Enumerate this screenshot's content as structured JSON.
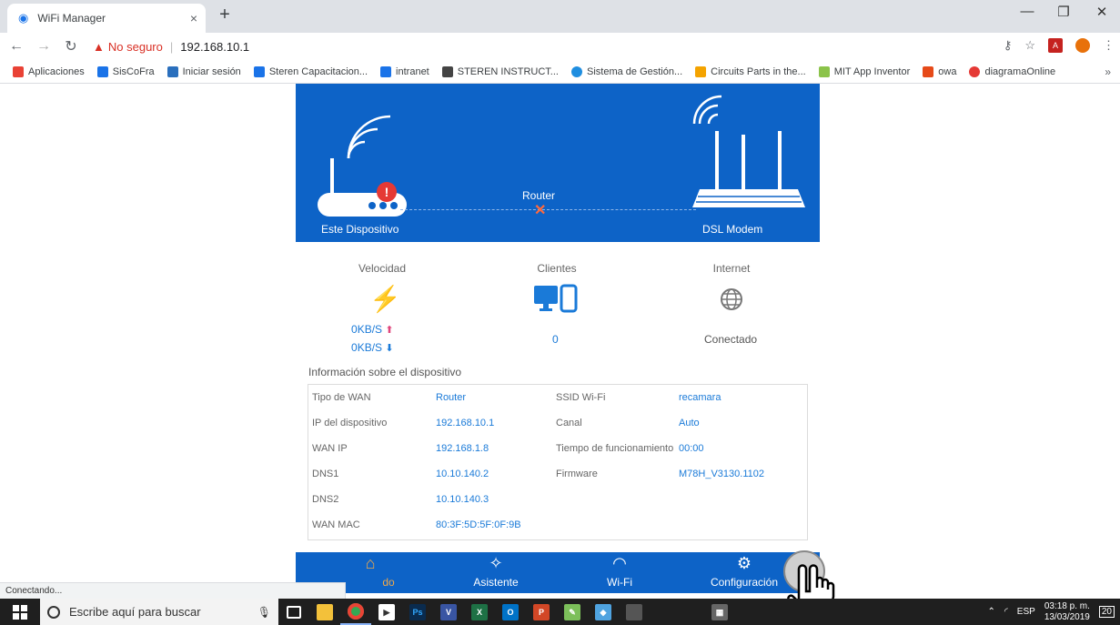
{
  "browser": {
    "tab_title": "WiFi Manager",
    "tab_close": "×",
    "new_tab": "+",
    "not_secure": "No seguro",
    "url": "192.168.10.1",
    "status": "Conectando..."
  },
  "bookmarks": [
    {
      "label": "Aplicaciones",
      "color": "#e94235"
    },
    {
      "label": "SisCoFra",
      "color": "#1a73e8"
    },
    {
      "label": "Iniciar sesión",
      "color": "#2a6fbd"
    },
    {
      "label": "Steren Capacitacion...",
      "color": "#1a73e8"
    },
    {
      "label": "intranet",
      "color": "#1a73e8"
    },
    {
      "label": "STEREN INSTRUCT...",
      "color": "#444444"
    },
    {
      "label": "Sistema de Gestión...",
      "color": "#1f8ee0"
    },
    {
      "label": "Circuits Parts in the...",
      "color": "#f4a300"
    },
    {
      "label": "MIT App Inventor",
      "color": "#8bc34a"
    },
    {
      "label": "owa",
      "color": "#e64a19"
    },
    {
      "label": "diagramaOnline",
      "color": "#e53935"
    }
  ],
  "banner": {
    "device_label": "Este Dispositivo",
    "router_label": "Router",
    "modem_label": "DSL Modem"
  },
  "stats": {
    "speed_label": "Velocidad",
    "speed_up_value": "0",
    "speed_up_unit": "KB/S",
    "speed_down_value": "0",
    "speed_down_unit": "KB/S",
    "clients_label": "Clientes",
    "clients_value": "0",
    "internet_label": "Internet",
    "internet_value": "Conectado"
  },
  "device_info": {
    "title": "Información sobre el dispositivo",
    "wan_type_label": "Tipo de WAN",
    "wan_type_value": "Router",
    "device_ip_label": "IP del dispositivo",
    "device_ip_value": "192.168.10.1",
    "wan_ip_label": "WAN IP",
    "wan_ip_value": "192.168.1.8",
    "dns1_label": "DNS1",
    "dns1_value": "10.10.140.2",
    "dns2_label": "DNS2",
    "dns2_value": "10.10.140.3",
    "wan_mac_label": "WAN MAC",
    "wan_mac_value": "80:3F:5D:5F:0F:9B",
    "ssid_label": "SSID Wi-Fi",
    "ssid_value": "recamara",
    "channel_label": "Canal",
    "channel_value": "Auto",
    "uptime_label": "Tiempo de funcionamiento",
    "uptime_value": "00:00",
    "firmware_label": "Firmware",
    "firmware_value": "M78H_V3130.1102"
  },
  "bottom_nav": {
    "home_label": "do",
    "wizard_label": "Asistente",
    "wifi_label": "Wi-Fi",
    "config_label": "Configuración"
  },
  "taskbar": {
    "search_placeholder": "Escribe aquí para buscar",
    "language": "ESP",
    "time": "03:18 p. m.",
    "date": "13/03/2019",
    "notifications": "20"
  },
  "colors": {
    "brand_blue": "#0d63c7",
    "value_blue": "#1a7ad8",
    "alert_red": "#e53935"
  }
}
